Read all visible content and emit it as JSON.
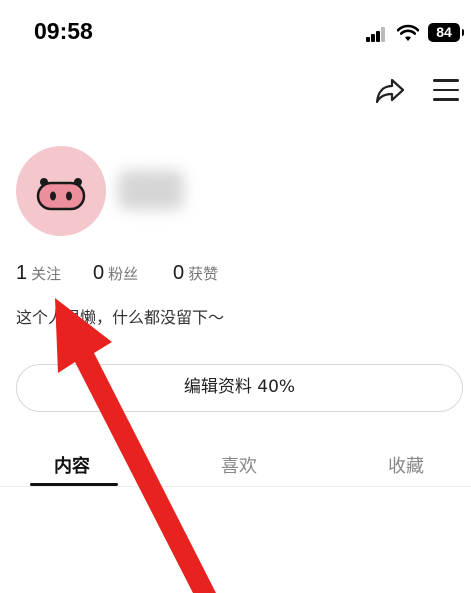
{
  "status_bar": {
    "time": "09:58",
    "battery": "84"
  },
  "header": {
    "share_icon": "share-icon",
    "menu_icon": "menu-icon"
  },
  "profile": {
    "avatar": "pig-face-avatar",
    "stats": [
      {
        "value": "1",
        "label": "关注"
      },
      {
        "value": "0",
        "label": "粉丝"
      },
      {
        "value": "0",
        "label": "获赞"
      }
    ],
    "bio": "这个人很懒，什么都没留下～",
    "edit_button": "编辑资料 40%"
  },
  "tabs": [
    {
      "label": "内容",
      "active": true
    },
    {
      "label": "喜欢",
      "active": false
    },
    {
      "label": "收藏",
      "active": false
    }
  ],
  "colors": {
    "annotation_arrow": "#e8231f",
    "avatar_bg": "#f3c7cc"
  }
}
